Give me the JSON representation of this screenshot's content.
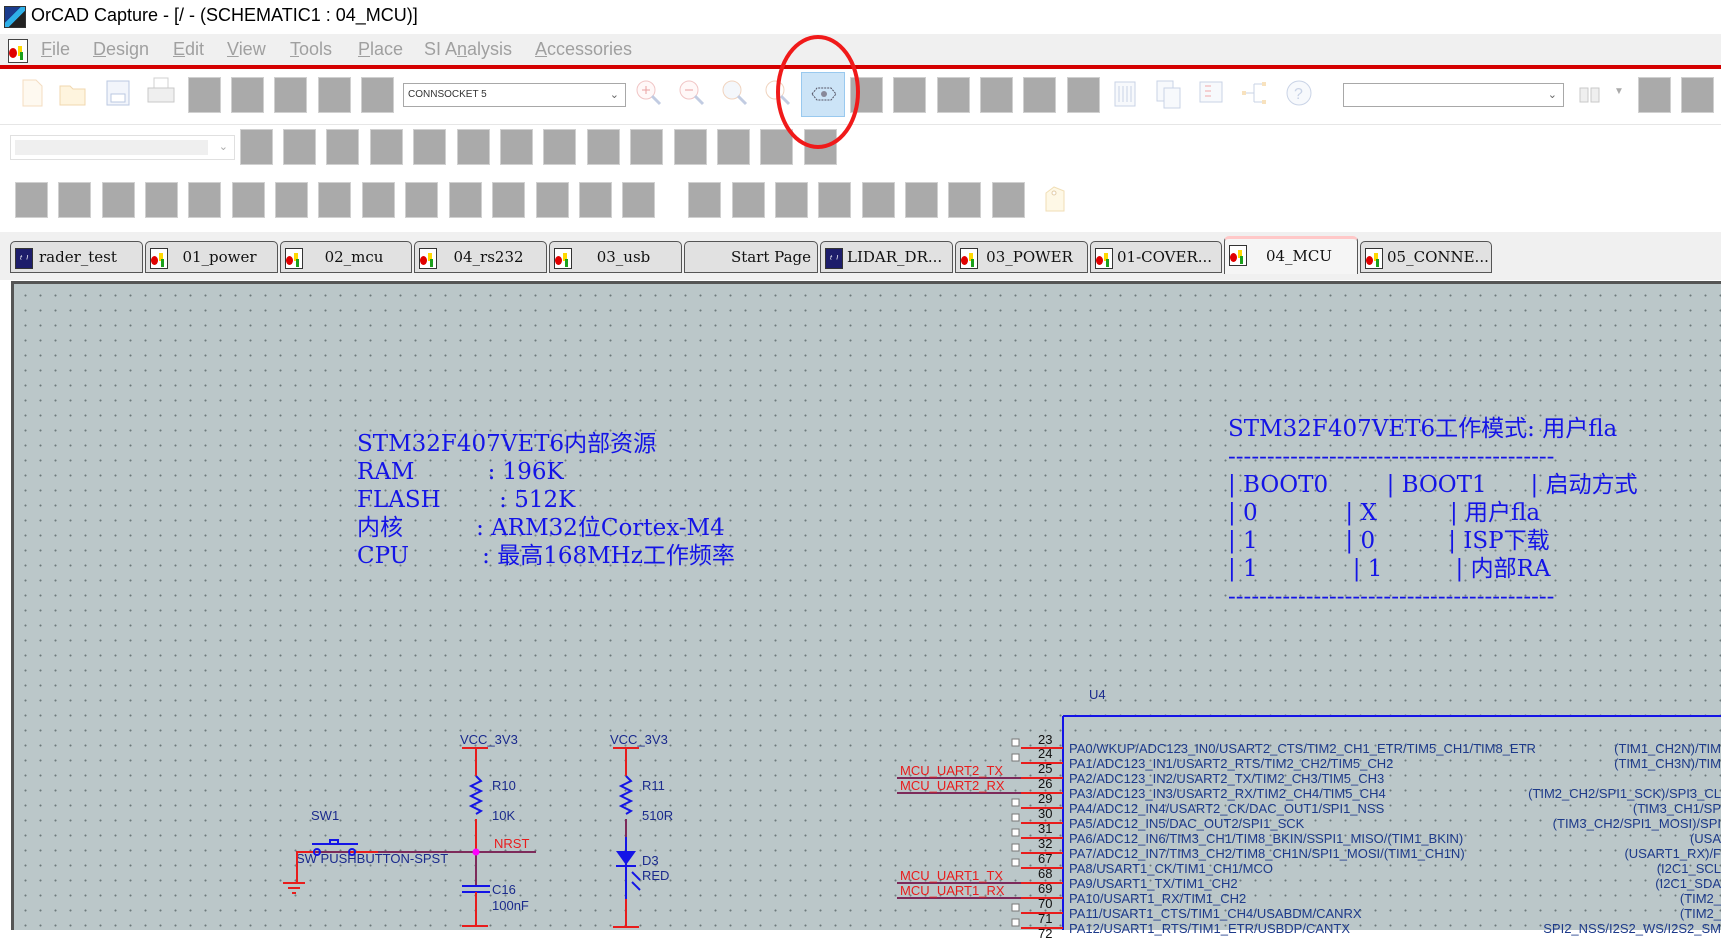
{
  "window": {
    "title": "OrCAD Capture - [/ - (SCHEMATIC1 : 04_MCU)]"
  },
  "menu": [
    {
      "label": "File",
      "accel": "F"
    },
    {
      "label": "Design",
      "accel": "D"
    },
    {
      "label": "Edit",
      "accel": "E"
    },
    {
      "label": "View",
      "accel": "V"
    },
    {
      "label": "Tools",
      "accel": "T"
    },
    {
      "label": "Place",
      "accel": "P"
    },
    {
      "label": "SI Analysis",
      "accel": "n"
    },
    {
      "label": "Accessories",
      "accel": "A"
    }
  ],
  "toolbar": {
    "part_combo": {
      "value": "CONNSOCKET 5"
    },
    "search_combo": {
      "value": ""
    },
    "style_combo": {
      "value": ""
    },
    "icons": [
      "new-file-icon",
      "open-folder-icon",
      "save-icon",
      "print-icon",
      "zoom-in-icon",
      "zoom-out-icon",
      "zoom-area-icon",
      "zoom-all-icon",
      "view-toggle-icon",
      "annotate-icon",
      "back-annotate-icon",
      "drc-icon",
      "netlist-icon",
      "help-icon",
      "find-binoculars-icon",
      "dropdown-arrow-icon",
      "tag-icon"
    ],
    "highlighted_button": "view-toggle-icon",
    "annotation": {
      "shape": "red ellipse",
      "target": "view-toggle-icon"
    }
  },
  "tabs": [
    {
      "label": "rader_test",
      "icon": "project-icon",
      "active": false
    },
    {
      "label": "01_power",
      "icon": "schematic-page-icon",
      "active": false
    },
    {
      "label": "02_mcu",
      "icon": "schematic-page-icon",
      "active": false
    },
    {
      "label": "04_rs232",
      "icon": "schematic-page-icon",
      "active": false
    },
    {
      "label": "03_usb",
      "icon": "schematic-page-icon",
      "active": false
    },
    {
      "label": "Start Page",
      "icon": "",
      "active": false
    },
    {
      "label": "LIDAR_DR...",
      "icon": "project-icon",
      "active": false
    },
    {
      "label": "03_POWER",
      "icon": "schematic-page-icon",
      "active": false
    },
    {
      "label": "01-COVER...",
      "icon": "schematic-page-icon",
      "active": false
    },
    {
      "label": "04_MCU",
      "icon": "schematic-page-icon",
      "active": true
    },
    {
      "label": "05_CONNE...",
      "icon": "schematic-page-icon",
      "active": false
    }
  ],
  "schematic": {
    "resources_note": {
      "lines": [
        "STM32F407VET6内部资源",
        "RAM          : 196K",
        "FLASH        : 512K",
        "内核          : ARM32位Cortex-M4",
        "CPU          : 最高168MHz工作频率"
      ]
    },
    "boot_note": {
      "lines": [
        "STM32F407VET6工作模式: 用户fla",
        "------------------------------------------",
        "| BOOT0        | BOOT1      | 启动方式",
        "| 0            | X          | 用户fla",
        "| 1            | 0          | ISP下载",
        "| 1             | 1          | 内部RA",
        "------------------------------------------"
      ]
    },
    "reset_circuit": {
      "power_label": "VCC_3V3",
      "resistor_ref": "R10",
      "resistor_value": "10K",
      "switch_ref": "SW1",
      "switch_value": "SW PUSHBUTTON-SPST",
      "net_label": "NRST",
      "cap_ref": "C16",
      "cap_value": "100nF"
    },
    "led_circuit": {
      "power_label": "VCC_3V3",
      "resistor_ref": "R11",
      "resistor_value": "510R",
      "led_ref": "D3",
      "led_value": "RED"
    },
    "mcu": {
      "ref": "U4",
      "top_pin": "23",
      "pins": [
        {
          "num": "24",
          "name": "PA0/WKUP/ADC123_IN0/USART2_CTS/TIM2_CH1_ETR/TIM5_CH1/TIM8_ETR",
          "right": "(TIM1_CH2N)/TIM",
          "net": "",
          "nc": true
        },
        {
          "num": "25",
          "name": "PA1/ADC123_IN1/USART2_RTS/TIM2_CH2/TIM5_CH2",
          "right": "(TIM1_CH3N)/TIM",
          "net": "",
          "nc": true
        },
        {
          "num": "26",
          "name": "PA2/ADC123_IN2/USART2_TX/TIM2_CH3/TIM5_CH3",
          "right": "",
          "net": "MCU_UART2_TX",
          "nc": false
        },
        {
          "num": "29",
          "name": "PA3/ADC123_IN3/USART2_RX/TIM2_CH4/TIM5_CH4",
          "right": "(TIM2_CH2/SPI1_SCK)/SPI3_CL",
          "net": "MCU_UART2_RX",
          "nc": false
        },
        {
          "num": "30",
          "name": "PA4/ADC12_IN4/USART2_CK/DAC_OUT1/SPI1_NSS",
          "right": "(TIM3_CH1/SP",
          "net": "",
          "nc": true
        },
        {
          "num": "31",
          "name": "PA5/ADC12_IN5/DAC_OUT2/SPI1_SCK",
          "right": "(TIM3_CH2/SPI1_MOSI)/SPI",
          "net": "",
          "nc": true
        },
        {
          "num": "32",
          "name": "PA6/ADC12_IN6/TIM3_CH1/TIM8_BKIN/SSPI1_MISO/(TIM1_BKIN)",
          "right": "(USA",
          "net": "",
          "nc": true
        },
        {
          "num": "67",
          "name": "PA7/ADC12_IN7/TIM3_CH2/TIM8_CH1N/SPI1_MOSI/(TIM1_CH1N)",
          "right": "(USART1_RX)/F",
          "net": "",
          "nc": true
        },
        {
          "num": "68",
          "name": "PA8/USART1_CK/TIM1_CH1/MCO",
          "right": "(I2C1_SCL",
          "net": "",
          "nc": true
        },
        {
          "num": "69",
          "name": "PA9/USART1_TX/TIM1_CH2",
          "right": "(I2C1_SDA",
          "net": "MCU_UART1_TX",
          "nc": false
        },
        {
          "num": "70",
          "name": "PA10/USART1_RX/TIM1_CH2",
          "right": "(TIM2_",
          "net": "MCU_UART1_RX",
          "nc": false
        },
        {
          "num": "71",
          "name": "PA11/USART1_CTS/TIM1_CH4/USABDM/CANRX",
          "right": "(TIM2_",
          "net": "",
          "nc": true
        },
        {
          "num": "72",
          "name": "PA12/USART1_RTS/TIM1_ETR/USBDP/CANTX",
          "right": "SPI2_NSS/I2S2_WS/I2S2_SM",
          "net": "",
          "nc": true
        }
      ]
    }
  },
  "colors": {
    "canvas_bg": "#bbc7c9",
    "note_text": "#1414e6",
    "wire": "#e81c1c",
    "component": "#1a2a8c",
    "junction": "#ff00ff",
    "accent_red": "#d40000",
    "highlight_btn": "#cce4f7"
  }
}
